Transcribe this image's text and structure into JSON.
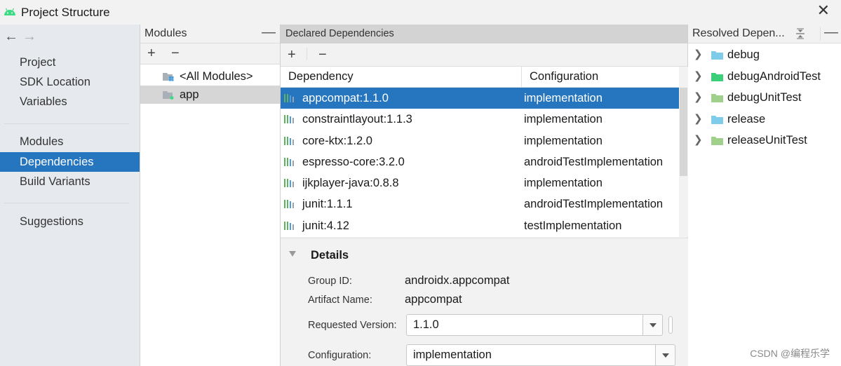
{
  "window": {
    "title": "Project Structure",
    "close_icon": "close-icon",
    "app_icon": "android-icon",
    "accent_color": "#2675bf"
  },
  "nav": {
    "back_icon": "←",
    "forward_icon": "→",
    "groups": [
      [
        "Project",
        "SDK Location",
        "Variables"
      ],
      [
        "Modules",
        "Dependencies",
        "Build Variants"
      ],
      [
        "Suggestions"
      ]
    ],
    "items": [
      {
        "label": "Project"
      },
      {
        "label": "SDK Location"
      },
      {
        "label": "Variables"
      },
      {
        "label": "Modules"
      },
      {
        "label": "Dependencies",
        "selected": true
      },
      {
        "label": "Build Variants"
      },
      {
        "label": "Suggestions"
      }
    ]
  },
  "modules_panel": {
    "title": "Modules",
    "minimize": "—",
    "add": "+",
    "remove": "−",
    "items": [
      {
        "label": "<All Modules>",
        "icon": "all-modules-folder-icon"
      },
      {
        "label": "app",
        "icon": "module-folder-icon",
        "selected": true
      }
    ]
  },
  "declared": {
    "title": "Declared Dependencies",
    "add": "+",
    "remove": "−",
    "columns": [
      "Dependency",
      "Configuration"
    ],
    "rows": [
      {
        "dependency": "appcompat:1.1.0",
        "configuration": "implementation",
        "selected": true
      },
      {
        "dependency": "constraintlayout:1.1.3",
        "configuration": "implementation"
      },
      {
        "dependency": "core-ktx:1.2.0",
        "configuration": "implementation"
      },
      {
        "dependency": "espresso-core:3.2.0",
        "configuration": "androidTestImplementation"
      },
      {
        "dependency": "ijkplayer-java:0.8.8",
        "configuration": "implementation"
      },
      {
        "dependency": "junit:1.1.1",
        "configuration": "androidTestImplementation"
      },
      {
        "dependency": "junit:4.12",
        "configuration": "testImplementation"
      }
    ]
  },
  "details": {
    "title": "Details",
    "group_id_label": "Group ID:",
    "group_id": "androidx.appcompat",
    "artifact_label": "Artifact Name:",
    "artifact": "appcompat",
    "version_label": "Requested Version:",
    "version": "1.1.0",
    "config_label": "Configuration:",
    "config": "implementation"
  },
  "resolved": {
    "title": "Resolved Depen...",
    "minimize": "—",
    "items": [
      {
        "label": "debug",
        "color": "#7ecbea"
      },
      {
        "label": "debugAndroidTest",
        "color": "#3ccf7a"
      },
      {
        "label": "debugUnitTest",
        "color": "#9fd18c"
      },
      {
        "label": "release",
        "color": "#7ecbea"
      },
      {
        "label": "releaseUnitTest",
        "color": "#9fd18c"
      }
    ]
  },
  "watermark": "CSDN @编程乐学"
}
